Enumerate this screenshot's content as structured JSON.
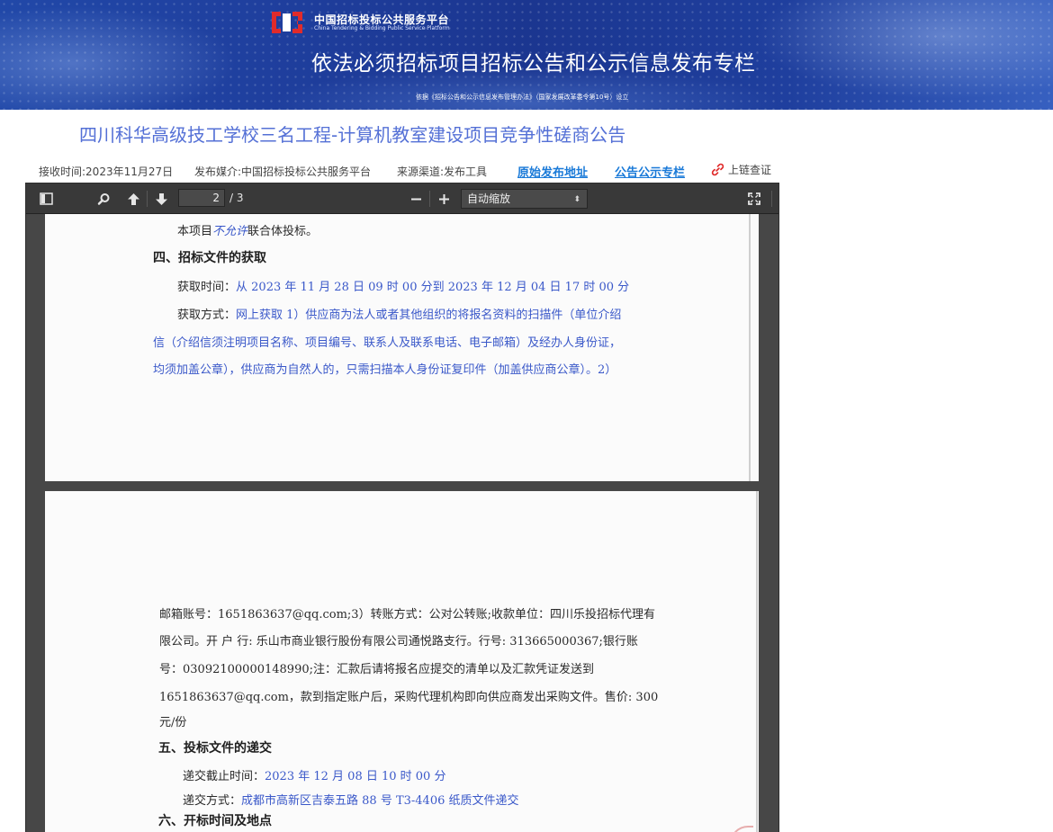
{
  "banner": {
    "logo_cn": "中国招标投标公共服务平台",
    "logo_en": "China Tendering & Bidding Public Service Platform",
    "main_title": "依法必须招标项目招标公告和公示信息发布专栏",
    "sub_note": "依据《招标公告和公示信息发布管理办法》（国家发展改革委令第10号）设立"
  },
  "notice_title": "四川科华高级技工学校三名工程-计算机教室建设项目竞争性磋商公告",
  "meta": {
    "received": "接收时间:2023年11月27日",
    "media": "发布媒介:中国招标投标公共服务平台",
    "source": "来源渠道:发布工具",
    "original_link": "原始发布地址",
    "column_link": "公告公示专栏",
    "chain_check": "上链查证"
  },
  "viewer": {
    "current_page": "2",
    "total_pages": "/ 3",
    "zoom": "自动缩放",
    "zoom_caret": "⬍"
  },
  "page1": {
    "l1_pre": "本项目",
    "l1_em": "不允许",
    "l1_post": "联合体投标。",
    "h4": "四、招标文件的获取",
    "time_label": "获取时间：",
    "time_value": "从 2023 年 11 月 28 日 09 时 00 分到 2023 年 12 月 04 日 17 时 00 分",
    "method_label": "获取方式：",
    "method_value": "网上获取 1）供应商为法人或者其他组织的将报名资料的扫描件（单位介绍",
    "method_l2": "信（介绍信须注明项目名称、项目编号、联系人及联系电话、电子邮箱）及经办人身份证，",
    "method_l3": "均须加盖公章），供应商为自然人的，只需扫描本人身份证复印件（加盖供应商公章）。2）"
  },
  "page2": {
    "p1": "邮箱账号：1651863637@qq.com;3）转账方式：公对公转账;收款单位：四川乐投招标代理有",
    "p2": "限公司。开 户 行: 乐山市商业银行股份有限公司通悦路支行。行号: 313665000367;银行账",
    "p3": "号：03092100000148990;注：汇款后请将报名应提交的清单以及汇款凭证发送到",
    "p4": "1651863637@qq.com，款到指定账户后，采购代理机构即向供应商发出采购文件。售价: 300",
    "p5": "元/份",
    "h5": "五、投标文件的递交",
    "deadline_label": "递交截止时间：",
    "deadline_value": "2023 年 12 月 08 日 10 时 00 分",
    "submit_label": "递交方式：",
    "submit_value": "成都市高新区吉泰五路 88 号 T3-4406 纸质文件递交",
    "h6": "六、开标时间及地点"
  },
  "colors": {
    "title": "#5470d6",
    "link": "#1a7ad8",
    "toolbar": "#393939",
    "viewer_bg": "#474747"
  },
  "icons": [
    "sidebar-toggle-icon",
    "search-icon",
    "previous-page-icon",
    "next-page-icon",
    "zoom-out-icon",
    "zoom-in-icon",
    "fullscreen-icon",
    "chain-link-icon",
    "platform-logo-icon"
  ]
}
